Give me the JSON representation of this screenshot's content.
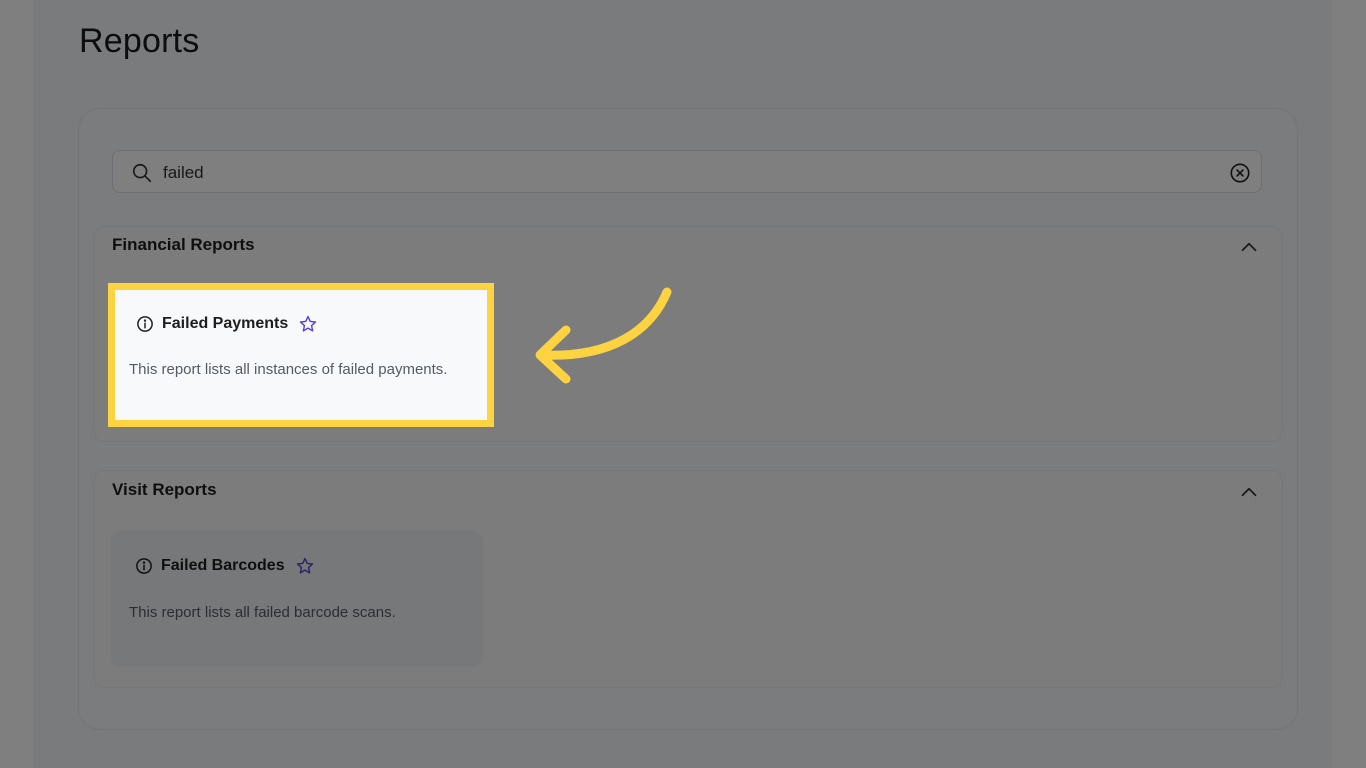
{
  "page": {
    "title": "Reports"
  },
  "search": {
    "value": "failed",
    "icon": "search-icon",
    "clear_icon": "clear-circle-icon"
  },
  "sections": [
    {
      "title": "Financial Reports",
      "expanded": true,
      "chevron": "chevron-up-icon",
      "reports": [
        {
          "title": "Failed Payments",
          "description": "This report lists all instances of failed payments.",
          "info_icon": "info-icon",
          "star_icon": "star-outline-icon",
          "highlighted": true
        }
      ]
    },
    {
      "title": "Visit Reports",
      "expanded": true,
      "chevron": "chevron-up-icon",
      "reports": [
        {
          "title": "Failed Barcodes",
          "description": "This report lists all failed barcode scans.",
          "info_icon": "info-icon",
          "star_icon": "star-outline-icon",
          "highlighted": false
        }
      ]
    }
  ],
  "colors": {
    "highlight": "#fdd341",
    "star": "#5b3fd6",
    "overlay": "rgba(0,0,0,0.5)"
  },
  "annotation": {
    "arrow_icon": "curved-arrow-left-icon"
  }
}
